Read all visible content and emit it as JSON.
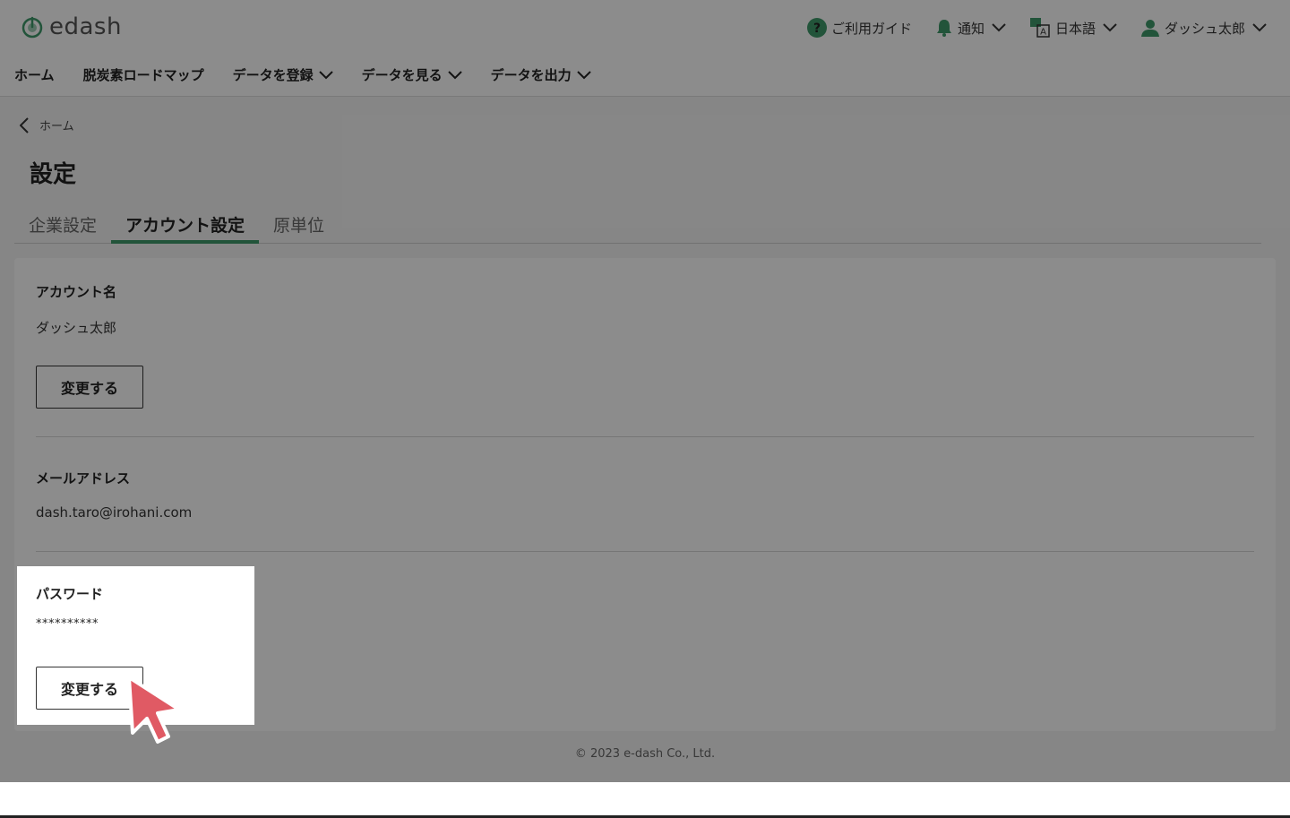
{
  "header": {
    "logo_text": "edash",
    "guide_label": "ご利用ガイド",
    "notify_label": "通知",
    "language_label": "日本語",
    "user_label": "ダッシュ太郎"
  },
  "nav": {
    "items": [
      {
        "label": "ホーム"
      },
      {
        "label": "脱炭素ロードマップ"
      },
      {
        "label": "データを登録"
      },
      {
        "label": "データを見る"
      },
      {
        "label": "データを出力"
      }
    ]
  },
  "breadcrumb": {
    "label": "ホーム"
  },
  "page_title": "設定",
  "tabs": [
    {
      "label": "企業設定",
      "active": false
    },
    {
      "label": "アカウント設定",
      "active": true
    },
    {
      "label": "原単位",
      "active": false
    }
  ],
  "account": {
    "name_label": "アカウント名",
    "name_value": "ダッシュ太郎",
    "name_button": "変更する",
    "email_label": "メールアドレス",
    "email_value": "dash.taro@irohani.com",
    "password_label": "パスワード",
    "password_value": "**********",
    "password_button": "変更する"
  },
  "footer": {
    "copyright": "© 2023 e-dash Co., Ltd."
  },
  "colors": {
    "accent": "#3f9a6b",
    "cursor": "#e05a64"
  }
}
